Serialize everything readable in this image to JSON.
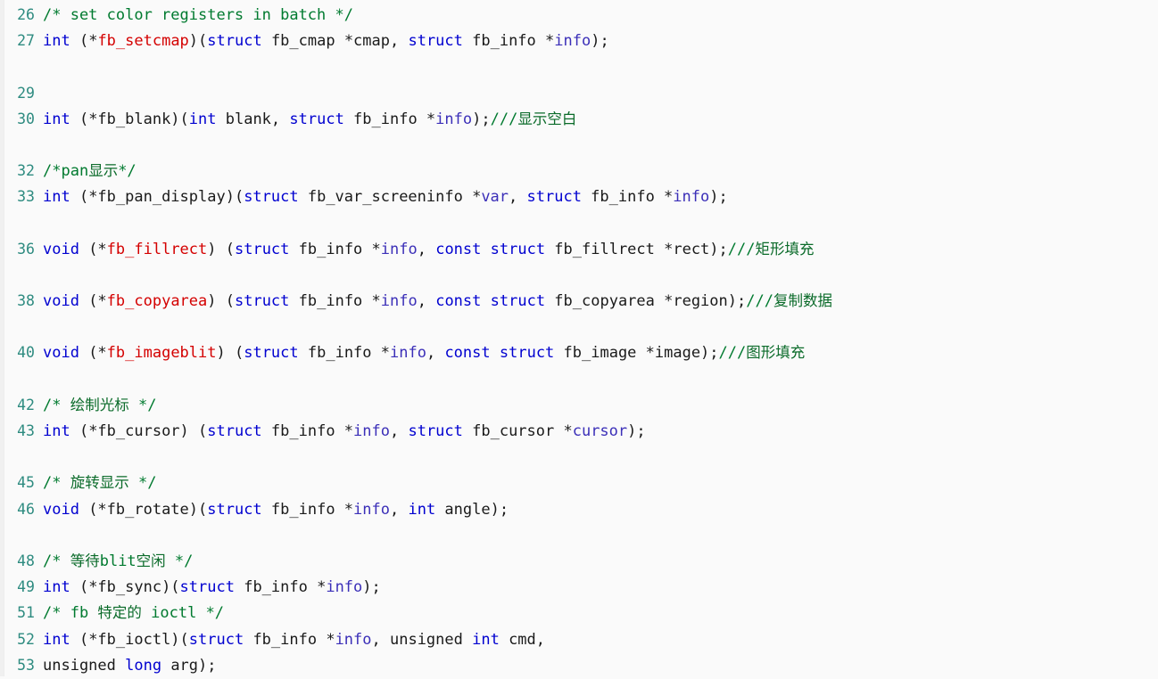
{
  "viewer": {
    "name": "code-listing",
    "language": "c",
    "background_color": "#fafafa",
    "line_number_color": "#2e8b80",
    "colors": {
      "keyword": "#0000d0",
      "function": "#d40000",
      "comment": "#007a2f",
      "variable": "#3b2fb8",
      "plain": "#1a1a1a",
      "cjk_comment": "#0b6b2a"
    }
  },
  "lines": [
    {
      "number": "26",
      "tokens": [
        {
          "text": "/* set color registers in batch */",
          "cls": "t-comment"
        }
      ]
    },
    {
      "number": "27",
      "tokens": [
        {
          "text": "int",
          "cls": "t-keyword"
        },
        {
          "text": " (*",
          "cls": "t-plain"
        },
        {
          "text": "fb_setcmap",
          "cls": "t-func"
        },
        {
          "text": ")(",
          "cls": "t-plain"
        },
        {
          "text": "struct",
          "cls": "t-keyword"
        },
        {
          "text": " fb_cmap *cmap, ",
          "cls": "t-plain"
        },
        {
          "text": "struct",
          "cls": "t-keyword"
        },
        {
          "text": " fb_info *",
          "cls": "t-plain"
        },
        {
          "text": "info",
          "cls": "t-var"
        },
        {
          "text": ");",
          "cls": "t-plain"
        }
      ]
    },
    {
      "number": "",
      "tokens": []
    },
    {
      "number": "29",
      "tokens": []
    },
    {
      "number": "30",
      "tokens": [
        {
          "text": "int",
          "cls": "t-keyword"
        },
        {
          "text": " (*fb_blank)(",
          "cls": "t-plain"
        },
        {
          "text": "int",
          "cls": "t-keyword"
        },
        {
          "text": " blank, ",
          "cls": "t-plain"
        },
        {
          "text": "struct",
          "cls": "t-keyword"
        },
        {
          "text": " fb_info *",
          "cls": "t-plain"
        },
        {
          "text": "info",
          "cls": "t-var"
        },
        {
          "text": ");",
          "cls": "t-plain"
        },
        {
          "text": "///",
          "cls": "t-comment"
        },
        {
          "text": "显示空白",
          "cls": "t-comment t-cjk"
        }
      ]
    },
    {
      "number": "",
      "tokens": []
    },
    {
      "number": "32",
      "tokens": [
        {
          "text": "/*pan",
          "cls": "t-comment"
        },
        {
          "text": "显示",
          "cls": "t-comment t-cjk"
        },
        {
          "text": "*/",
          "cls": "t-comment"
        }
      ]
    },
    {
      "number": "33",
      "tokens": [
        {
          "text": "int",
          "cls": "t-keyword"
        },
        {
          "text": " (*fb_pan_display)(",
          "cls": "t-plain"
        },
        {
          "text": "struct",
          "cls": "t-keyword"
        },
        {
          "text": " fb_var_screeninfo *",
          "cls": "t-plain"
        },
        {
          "text": "var",
          "cls": "t-var"
        },
        {
          "text": ", ",
          "cls": "t-plain"
        },
        {
          "text": "struct",
          "cls": "t-keyword"
        },
        {
          "text": " fb_info *",
          "cls": "t-plain"
        },
        {
          "text": "info",
          "cls": "t-var"
        },
        {
          "text": ");",
          "cls": "t-plain"
        }
      ]
    },
    {
      "number": "",
      "tokens": []
    },
    {
      "number": "36",
      "tokens": [
        {
          "text": "void",
          "cls": "t-keyword"
        },
        {
          "text": " (*",
          "cls": "t-plain"
        },
        {
          "text": "fb_fillrect",
          "cls": "t-func"
        },
        {
          "text": ") (",
          "cls": "t-plain"
        },
        {
          "text": "struct",
          "cls": "t-keyword"
        },
        {
          "text": " fb_info *",
          "cls": "t-plain"
        },
        {
          "text": "info",
          "cls": "t-var"
        },
        {
          "text": ", ",
          "cls": "t-plain"
        },
        {
          "text": "const",
          "cls": "t-keyword"
        },
        {
          "text": " ",
          "cls": "t-plain"
        },
        {
          "text": "struct",
          "cls": "t-keyword"
        },
        {
          "text": " fb_fillrect *rect);",
          "cls": "t-plain"
        },
        {
          "text": "///",
          "cls": "t-comment"
        },
        {
          "text": "矩形填充",
          "cls": "t-comment t-cjk"
        }
      ]
    },
    {
      "number": "",
      "tokens": []
    },
    {
      "number": "38",
      "tokens": [
        {
          "text": "void",
          "cls": "t-keyword"
        },
        {
          "text": " (*",
          "cls": "t-plain"
        },
        {
          "text": "fb_copyarea",
          "cls": "t-func"
        },
        {
          "text": ") (",
          "cls": "t-plain"
        },
        {
          "text": "struct",
          "cls": "t-keyword"
        },
        {
          "text": " fb_info *",
          "cls": "t-plain"
        },
        {
          "text": "info",
          "cls": "t-var"
        },
        {
          "text": ", ",
          "cls": "t-plain"
        },
        {
          "text": "const",
          "cls": "t-keyword"
        },
        {
          "text": " ",
          "cls": "t-plain"
        },
        {
          "text": "struct",
          "cls": "t-keyword"
        },
        {
          "text": " fb_copyarea *region);",
          "cls": "t-plain"
        },
        {
          "text": "///",
          "cls": "t-comment"
        },
        {
          "text": "复制数据",
          "cls": "t-comment t-cjk"
        }
      ]
    },
    {
      "number": "",
      "tokens": []
    },
    {
      "number": "40",
      "tokens": [
        {
          "text": "void",
          "cls": "t-keyword"
        },
        {
          "text": " (*",
          "cls": "t-plain"
        },
        {
          "text": "fb_imageblit",
          "cls": "t-func"
        },
        {
          "text": ") (",
          "cls": "t-plain"
        },
        {
          "text": "struct",
          "cls": "t-keyword"
        },
        {
          "text": " fb_info *",
          "cls": "t-plain"
        },
        {
          "text": "info",
          "cls": "t-var"
        },
        {
          "text": ", ",
          "cls": "t-plain"
        },
        {
          "text": "const",
          "cls": "t-keyword"
        },
        {
          "text": " ",
          "cls": "t-plain"
        },
        {
          "text": "struct",
          "cls": "t-keyword"
        },
        {
          "text": " fb_image *image);",
          "cls": "t-plain"
        },
        {
          "text": "///",
          "cls": "t-comment"
        },
        {
          "text": "图形填充",
          "cls": "t-comment t-cjk"
        }
      ]
    },
    {
      "number": "",
      "tokens": []
    },
    {
      "number": "42",
      "tokens": [
        {
          "text": "/* ",
          "cls": "t-comment"
        },
        {
          "text": "绘制光标",
          "cls": "t-comment t-cjk"
        },
        {
          "text": " */",
          "cls": "t-comment"
        }
      ]
    },
    {
      "number": "43",
      "tokens": [
        {
          "text": "int",
          "cls": "t-keyword"
        },
        {
          "text": " (*fb_cursor) (",
          "cls": "t-plain"
        },
        {
          "text": "struct",
          "cls": "t-keyword"
        },
        {
          "text": " fb_info *",
          "cls": "t-plain"
        },
        {
          "text": "info",
          "cls": "t-var"
        },
        {
          "text": ", ",
          "cls": "t-plain"
        },
        {
          "text": "struct",
          "cls": "t-keyword"
        },
        {
          "text": " fb_cursor *",
          "cls": "t-plain"
        },
        {
          "text": "cursor",
          "cls": "t-var"
        },
        {
          "text": ");",
          "cls": "t-plain"
        }
      ]
    },
    {
      "number": "",
      "tokens": []
    },
    {
      "number": "45",
      "tokens": [
        {
          "text": "/* ",
          "cls": "t-comment"
        },
        {
          "text": "旋转显示",
          "cls": "t-comment t-cjk"
        },
        {
          "text": " */",
          "cls": "t-comment"
        }
      ]
    },
    {
      "number": "46",
      "tokens": [
        {
          "text": "void",
          "cls": "t-keyword"
        },
        {
          "text": " (*fb_rotate)(",
          "cls": "t-plain"
        },
        {
          "text": "struct",
          "cls": "t-keyword"
        },
        {
          "text": " fb_info *",
          "cls": "t-plain"
        },
        {
          "text": "info",
          "cls": "t-var"
        },
        {
          "text": ", ",
          "cls": "t-plain"
        },
        {
          "text": "int",
          "cls": "t-keyword"
        },
        {
          "text": " angle);",
          "cls": "t-plain"
        }
      ]
    },
    {
      "number": "",
      "tokens": []
    },
    {
      "number": "48",
      "tokens": [
        {
          "text": "/* ",
          "cls": "t-comment"
        },
        {
          "text": "等待",
          "cls": "t-comment t-cjk"
        },
        {
          "text": "blit",
          "cls": "t-comment"
        },
        {
          "text": "空闲",
          "cls": "t-comment t-cjk"
        },
        {
          "text": " */",
          "cls": "t-comment"
        }
      ]
    },
    {
      "number": "49",
      "tokens": [
        {
          "text": "int",
          "cls": "t-keyword"
        },
        {
          "text": " (*fb_sync)(",
          "cls": "t-plain"
        },
        {
          "text": "struct",
          "cls": "t-keyword"
        },
        {
          "text": " fb_info *",
          "cls": "t-plain"
        },
        {
          "text": "info",
          "cls": "t-var"
        },
        {
          "text": ");",
          "cls": "t-plain"
        }
      ]
    },
    {
      "number": "51",
      "tokens": [
        {
          "text": "/* fb ",
          "cls": "t-comment"
        },
        {
          "text": "特定的",
          "cls": "t-comment t-cjk"
        },
        {
          "text": " ioctl */",
          "cls": "t-comment"
        }
      ]
    },
    {
      "number": "52",
      "tokens": [
        {
          "text": "int",
          "cls": "t-keyword"
        },
        {
          "text": " (*fb_ioctl)(",
          "cls": "t-plain"
        },
        {
          "text": "struct",
          "cls": "t-keyword"
        },
        {
          "text": " fb_info *",
          "cls": "t-plain"
        },
        {
          "text": "info",
          "cls": "t-var"
        },
        {
          "text": ", unsigned ",
          "cls": "t-plain"
        },
        {
          "text": "int",
          "cls": "t-keyword"
        },
        {
          "text": " cmd,",
          "cls": "t-plain"
        }
      ]
    },
    {
      "number": "53",
      "tokens": [
        {
          "text": "unsigned ",
          "cls": "t-plain"
        },
        {
          "text": "long",
          "cls": "t-keyword"
        },
        {
          "text": " arg);",
          "cls": "t-plain"
        }
      ]
    }
  ]
}
